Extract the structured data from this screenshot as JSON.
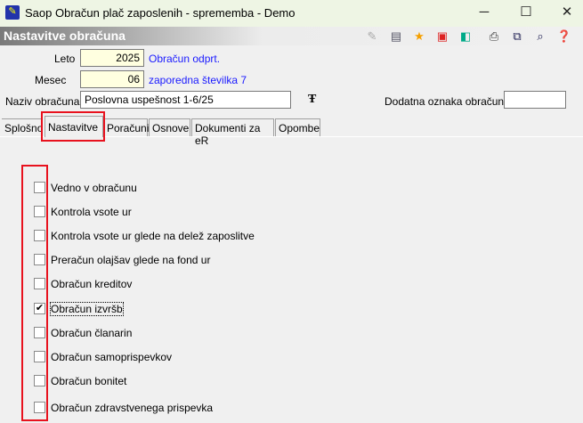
{
  "window": {
    "title": "Saop Obračun plač zaposlenih - sprememba - Demo",
    "minimize": "─",
    "maximize": "☐",
    "close": "✕"
  },
  "header": {
    "title": "Nastavitve obračuna",
    "toolbar_icons": [
      "edit-icon",
      "columns-icon",
      "star-icon",
      "delete-icon",
      "cube-icon",
      "print-icon",
      "copy-icon",
      "search-db-icon",
      "help-book-icon"
    ]
  },
  "form": {
    "leto_label": "Leto",
    "leto_value": "2025",
    "status": "Obračun odprt.",
    "mesec_label": "Mesec",
    "mesec_value": "06",
    "sequence": "zaporedna številka 7",
    "naziv_label": "Naziv obračuna",
    "naziv_value": "Poslovna uspešnost 1-6/25",
    "dodatna_label": "Dodatna oznaka obračuna",
    "dodatna_value": ""
  },
  "tabs": [
    {
      "label": "Splošno"
    },
    {
      "label": "Nastavitve",
      "active": true
    },
    {
      "label": "Poračuni"
    },
    {
      "label": "Osnove"
    },
    {
      "label": "Dokumenti za eR"
    },
    {
      "label": "Opombe"
    }
  ],
  "checkboxes": [
    {
      "label": "Vedno v obračunu",
      "checked": false
    },
    {
      "label": "Kontrola vsote ur",
      "checked": false
    },
    {
      "label": "Kontrola vsote ur glede na delež zaposlitve",
      "checked": false
    },
    {
      "label": "Preračun olajšav glede na fond ur",
      "checked": false
    },
    {
      "label": "Obračun kreditov",
      "checked": false
    },
    {
      "label": "Obračun izvršb",
      "checked": true
    },
    {
      "label": "Obračun članarin",
      "checked": false
    },
    {
      "label": "Obračun samoprispevkov",
      "checked": false
    },
    {
      "label": "Obračun bonitet",
      "checked": false
    },
    {
      "label": "Obračun zdravstvenega prispevka",
      "checked": false
    }
  ],
  "colors": {
    "highlight": "#e8121e",
    "link": "#1a1aff",
    "field_bg": "#ffffe0"
  }
}
